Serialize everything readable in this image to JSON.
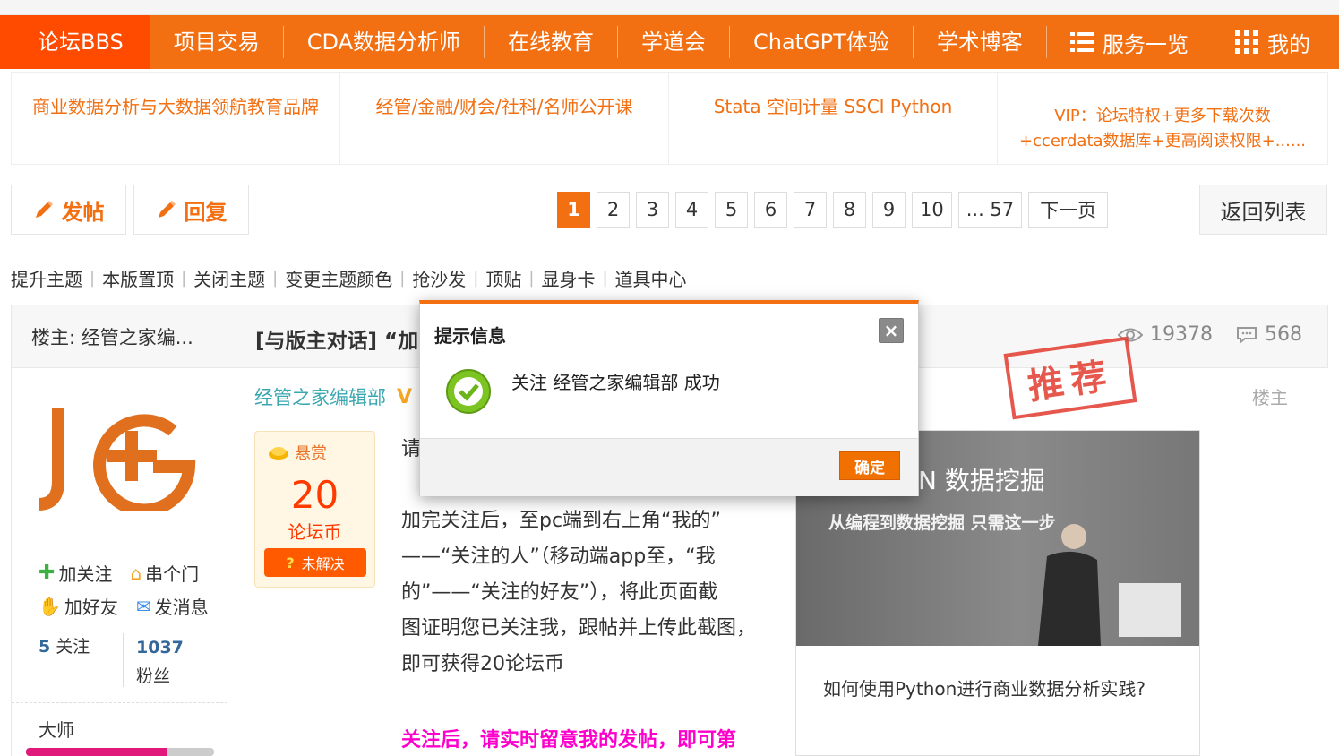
{
  "nav": {
    "items": [
      "论坛BBS",
      "项目交易",
      "CDA数据分析师",
      "在线教育",
      "学道会",
      "ChatGPT体验",
      "学术博客"
    ],
    "services": "服务一览",
    "mine": "我的"
  },
  "banner": {
    "cells": [
      "商业数据分析与大数据领航教育品牌",
      "经管/金融/财会/社科/名师公开课",
      "Stata 空间计量 SSCI Python"
    ],
    "vip_line1": "VIP：论坛特权+更多下载次数",
    "vip_line2": "+ccerdata数据库+更高阅读权限+......"
  },
  "actions": {
    "post": "发帖",
    "reply": "回复",
    "back": "返回列表"
  },
  "pager": {
    "pages": [
      "1",
      "2",
      "3",
      "4",
      "5",
      "6",
      "7",
      "8",
      "9",
      "10"
    ],
    "last": "... 57",
    "next": "下一页",
    "current": 1
  },
  "moderation": [
    "提升主题",
    "本版置顶",
    "关闭主题",
    "变更主题颜色",
    "抢沙发",
    "顶贴",
    "显身卡",
    "道具中心"
  ],
  "post": {
    "owner_label": "楼主: 经管之家编...",
    "title": "[与版主对话] “加",
    "views": "19378",
    "replies": "568",
    "author": "经管之家编辑部",
    "author_badge": "V",
    "floor": "楼主",
    "stamp": "推荐",
    "body_partial": "请",
    "body_lines": [
      "加完关注后，至pc端到右上角“我的”",
      "——“关注的人”（移动端app至，“我",
      "的”——“关注的好友”），将此页面截",
      "图证明您已关注我，跟帖并上传此截图，",
      "即可获得20论坛币"
    ],
    "highlight": "关注后，请实时留意我的发帖，即可第"
  },
  "author_panel": {
    "follow": "加关注",
    "visit": "串个门",
    "add_friend": "加好友",
    "message": "发消息",
    "following_count": "5",
    "following_label": "关注",
    "fans_count": "1037",
    "fans_label": "粉丝",
    "rank": "大师",
    "rank_progress": 0.75
  },
  "reward": {
    "label": "悬赏",
    "amount": "20",
    "unit": "论坛币",
    "status_mark": "?",
    "status": "未解决"
  },
  "ad": {
    "headline_partial": "N 数据挖掘",
    "sub": "从编程到数据挖掘 只需这一步",
    "caption": "如何使用Python进行商业数据分析实践?"
  },
  "dialog": {
    "title": "提示信息",
    "close": "×",
    "message": "关注 经管之家编辑部 成功",
    "ok": "确定"
  },
  "colors": {
    "brand": "#f26f12",
    "active_nav": "#ff4b00",
    "accent_pink": "#ff00cc"
  }
}
